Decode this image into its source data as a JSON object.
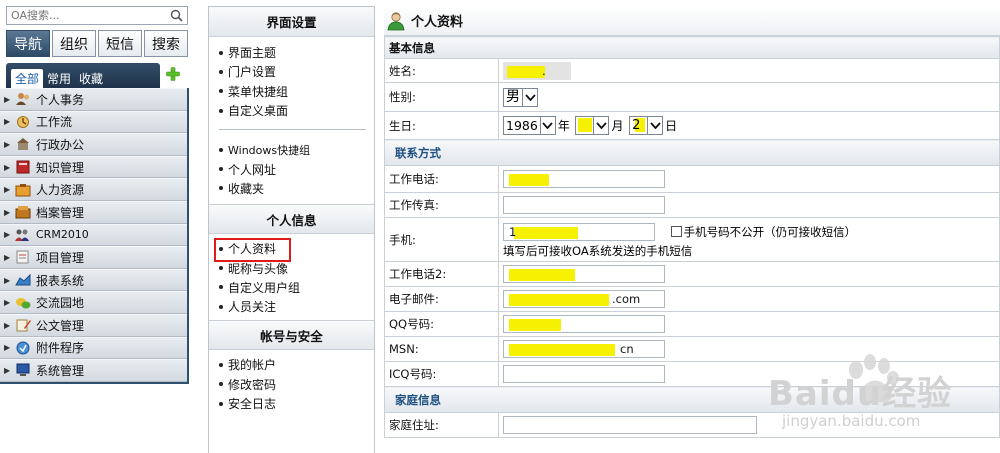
{
  "search": {
    "placeholder": "OA搜索..."
  },
  "main_tabs": [
    "导航",
    "组织",
    "短信",
    "搜索"
  ],
  "sub_tabs": [
    "全部",
    "常用",
    "收藏"
  ],
  "nav_items": [
    {
      "label": "个人事务",
      "icon": "people-icon"
    },
    {
      "label": "工作流",
      "icon": "workflow-icon"
    },
    {
      "label": "行政办公",
      "icon": "office-icon"
    },
    {
      "label": "知识管理",
      "icon": "book-icon"
    },
    {
      "label": "人力资源",
      "icon": "hr-icon"
    },
    {
      "label": "档案管理",
      "icon": "archive-icon"
    },
    {
      "label": "CRM2010",
      "icon": "crm-icon"
    },
    {
      "label": "项目管理",
      "icon": "project-icon"
    },
    {
      "label": "报表系统",
      "icon": "report-icon"
    },
    {
      "label": "交流园地",
      "icon": "chat-icon"
    },
    {
      "label": "公文管理",
      "icon": "document-icon"
    },
    {
      "label": "附件程序",
      "icon": "attachment-icon"
    },
    {
      "label": "系统管理",
      "icon": "system-icon"
    }
  ],
  "settings_menu": {
    "ui_section": {
      "title": "界面设置",
      "group1": [
        "界面主题",
        "门户设置",
        "菜单快捷组",
        "自定义桌面"
      ],
      "group2": [
        "Windows快捷组",
        "个人网址",
        "收藏夹"
      ]
    },
    "personal_section": {
      "title": "个人信息",
      "items": [
        "个人资料",
        "昵称与头像",
        "自定义用户组",
        "人员关注"
      ]
    },
    "account_section": {
      "title": "帐号与安全",
      "items": [
        "我的帐户",
        "修改密码",
        "安全日志"
      ]
    }
  },
  "profile": {
    "title": "个人资料",
    "basic_header": "基本信息",
    "name_label": "姓名:",
    "name_value": ".",
    "gender_label": "性别:",
    "gender_value": "男",
    "birthday_label": "生日:",
    "birth_year": "1986",
    "year_unit": "年",
    "birth_month": "",
    "month_unit": "月",
    "birth_day": "2",
    "day_unit": "日",
    "contact_header": "联系方式",
    "work_phone_label": "工作电话:",
    "work_fax_label": "工作传真:",
    "mobile_label": "手机:",
    "mobile_value": "1",
    "hide_mobile_label": "手机号码不公开（仍可接收短信）",
    "mobile_note": "填写后可接收OA系统发送的手机短信",
    "work_phone2_label": "工作电话2:",
    "email_label": "电子邮件:",
    "email_value": ".com",
    "qq_label": "QQ号码:",
    "msn_label": "MSN:",
    "msn_value": "cn",
    "icq_label": "ICQ号码:",
    "family_header": "家庭信息",
    "home_address_label": "家庭住址:"
  },
  "watermark": {
    "brand": "Baidu经验",
    "url": "jingyan.baidu.com"
  },
  "colors": {
    "nav_active": "#2d4a66",
    "highlight": "#f6f103",
    "selection_box": "#e11b1b",
    "section_blue": "#1e4f80"
  }
}
